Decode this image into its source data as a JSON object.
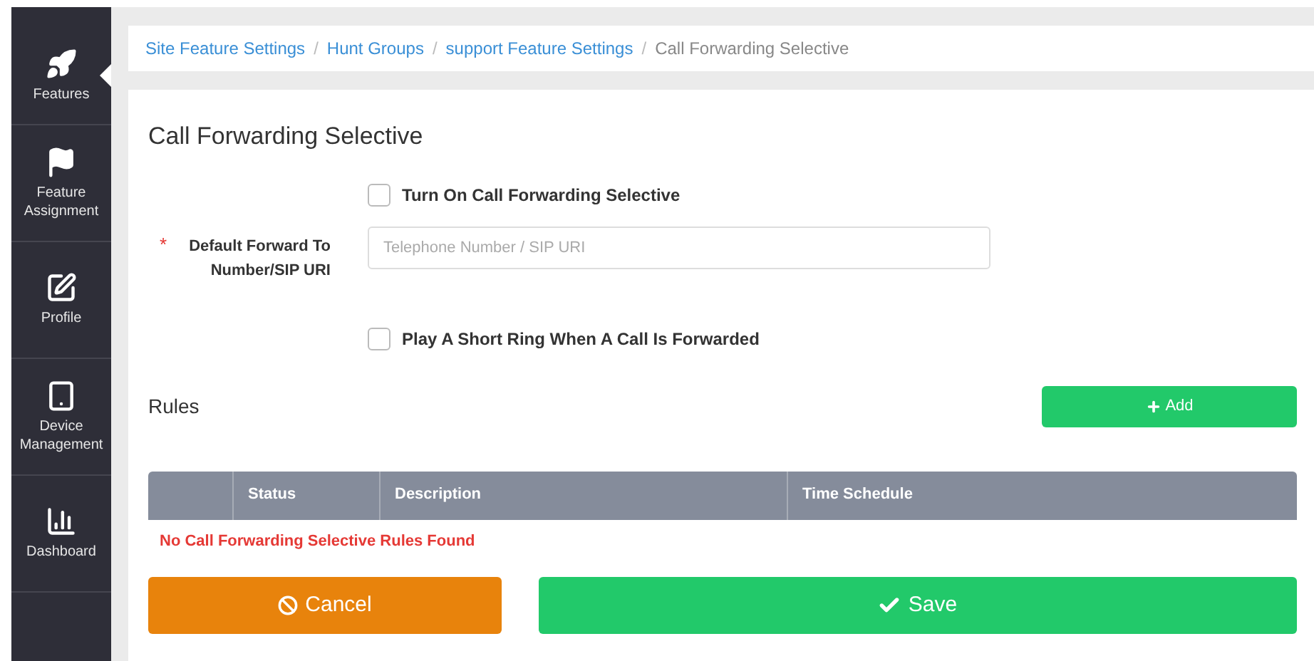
{
  "sidebar": {
    "items": [
      {
        "kind": "rocket",
        "label": "Features",
        "selected": true
      },
      {
        "kind": "flag",
        "label": "Feature Assignment",
        "selected": false
      },
      {
        "kind": "edit",
        "label": "Profile",
        "selected": false
      },
      {
        "kind": "tablet",
        "label": "Device Management",
        "selected": false
      },
      {
        "kind": "chart",
        "label": "Dashboard",
        "selected": false
      }
    ]
  },
  "breadcrumb": {
    "links": [
      "Site Feature Settings",
      "Hunt Groups",
      "support Feature Settings"
    ],
    "separator": "/",
    "current": "Call Forwarding Selective"
  },
  "form": {
    "title": "Call Forwarding Selective",
    "turn_on": {
      "label": "Turn On Call Forwarding Selective",
      "checked": false
    },
    "default_forward": {
      "required_mark": "*",
      "label": "Default Forward To Number/SIP URI",
      "placeholder": "Telephone Number / SIP URI"
    },
    "short_ring": {
      "label": "Play A Short Ring When A Call Is Forwarded",
      "checked": false
    }
  },
  "rules": {
    "title": "Rules",
    "add_button": "Add",
    "table": {
      "columns": [
        "",
        "Status",
        "Description",
        "Time Schedule"
      ],
      "empty_message": "No Call Forwarding Selective Rules Found"
    }
  },
  "buttons": {
    "cancel": "Cancel",
    "save": "Save"
  }
}
